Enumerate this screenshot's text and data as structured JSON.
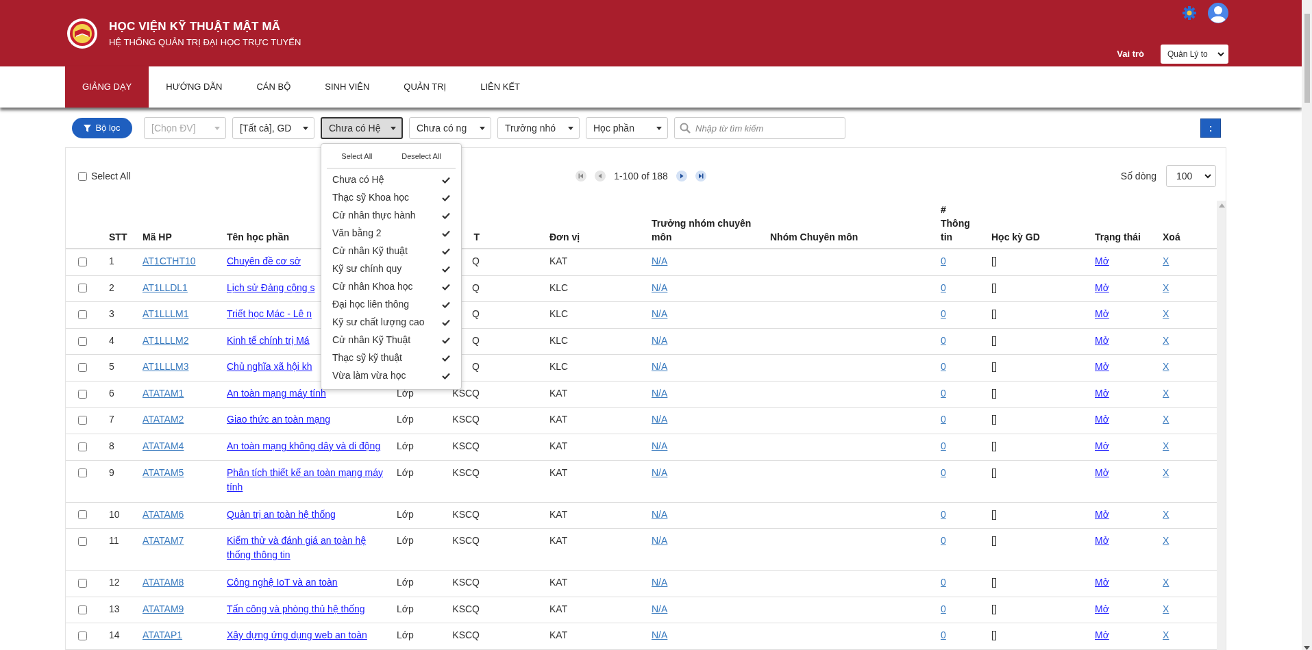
{
  "header": {
    "title": "HỌC VIỆN KỸ THUẬT MẬT MÃ",
    "subtitle": "HỆ THỐNG QUẢN TRỊ ĐẠI HỌC TRỰC TUYẾN",
    "role_label": "Vai trò",
    "role_select": "Quản Lý to"
  },
  "nav": [
    {
      "label": "GIẢNG DẠY",
      "selected": true
    },
    {
      "label": "HƯỚNG DẪN",
      "selected": false
    },
    {
      "label": "CÁN BỘ",
      "selected": false
    },
    {
      "label": "SINH VIÊN",
      "selected": false
    },
    {
      "label": "QUẢN TRỊ",
      "selected": false
    },
    {
      "label": "LIÊN KẾT",
      "selected": false
    }
  ],
  "filters": {
    "filter_button": "Bộ lọc",
    "dropdowns": [
      {
        "label": "[Chọn ĐV]",
        "disabled": true,
        "open": false
      },
      {
        "label": "[Tất cả], GD",
        "disabled": false,
        "open": false
      },
      {
        "label": "Chưa có Hệ",
        "disabled": false,
        "open": true
      },
      {
        "label": "Chưa có ng",
        "disabled": false,
        "open": false
      },
      {
        "label": "Trưởng nhó",
        "disabled": false,
        "open": false
      },
      {
        "label": "Học phần",
        "disabled": false,
        "open": false
      }
    ],
    "search": {
      "placeholder": "Nhập từ tìm kiếm"
    },
    "more_button": ":"
  },
  "dropdown_menu": {
    "select_all": "Select All",
    "deselect_all": "Deselect All",
    "items": [
      {
        "label": "Chưa có Hệ",
        "checked": true
      },
      {
        "label": "Thạc sỹ Khoa học",
        "checked": true
      },
      {
        "label": "Cử nhân thực hành",
        "checked": true
      },
      {
        "label": "Văn bằng 2",
        "checked": true
      },
      {
        "label": "Cử nhân Kỹ thuật",
        "checked": true
      },
      {
        "label": "Kỹ sư chính quy",
        "checked": true
      },
      {
        "label": "Cử nhân Khoa học",
        "checked": true
      },
      {
        "label": "Đại học liên thông",
        "checked": true
      },
      {
        "label": "Kỹ sư chất lượng cao",
        "checked": true
      },
      {
        "label": "Cử nhân Kỹ Thuật",
        "checked": true
      },
      {
        "label": "Thạc sỹ kỹ thuật",
        "checked": true
      },
      {
        "label": "Vừa làm vừa học",
        "checked": true
      }
    ]
  },
  "toolbar": {
    "select_all": {
      "label": "Select All",
      "checked": false
    },
    "pagination": "1-100 of 188",
    "rows_label": "Số dòng",
    "rows_select": "100"
  },
  "table": {
    "columns": [
      {
        "kind": "text",
        "label": "STT"
      },
      {
        "kind": "link",
        "label": "Mã HP"
      },
      {
        "kind": "title-link",
        "label": "Tên học phần"
      },
      {
        "kind": "text"
      },
      {
        "kind": "right",
        "label": "T"
      },
      {
        "kind": "text",
        "label": "Đơn vị"
      },
      {
        "kind": "link",
        "label": "Trưởng nhóm chuyên môn"
      },
      {
        "kind": "text",
        "label": "Nhóm Chuyên môn"
      },
      {
        "kind": "link",
        "label": "# Thông tin"
      },
      {
        "kind": "text",
        "label": "Học kỳ GD"
      },
      {
        "kind": "title-link",
        "label": "Trạng thái"
      },
      {
        "kind": "link",
        "label": "Xoá"
      }
    ],
    "rows": [
      {
        "checked": false,
        "stt": "1",
        "code": "AT1CTHT10",
        "name": "Chuyên đề cơ sở",
        "program": "Q",
        "unit": "KAT",
        "lead": "N/A",
        "info": "0",
        "semester": "[]",
        "status": "Mở",
        "delete": "X"
      },
      {
        "checked": false,
        "stt": "2",
        "code": "AT1LLDL1",
        "name": "Lịch sử Đảng cộng s",
        "program": "Q",
        "unit": "KLC",
        "lead": "N/A",
        "info": "0",
        "semester": "[]",
        "status": "Mở",
        "delete": "X"
      },
      {
        "checked": false,
        "stt": "3",
        "code": "AT1LLLM1",
        "name": "Triết học Mác - Lê n",
        "program": "Q",
        "unit": "KLC",
        "lead": "N/A",
        "info": "0",
        "semester": "[]",
        "status": "Mở",
        "delete": "X"
      },
      {
        "checked": false,
        "stt": "4",
        "code": "AT1LLLM2",
        "name": "Kinh tế chính trị Má",
        "program": "Q",
        "unit": "KLC",
        "lead": "N/A",
        "info": "0",
        "semester": "[]",
        "status": "Mở",
        "delete": "X"
      },
      {
        "checked": false,
        "stt": "5",
        "code": "AT1LLLM3",
        "name": "Chủ nghĩa xã hội kh",
        "program": "Q",
        "unit": "KLC",
        "lead": "N/A",
        "info": "0",
        "semester": "[]",
        "status": "Mở",
        "delete": "X"
      },
      {
        "checked": false,
        "stt": "6",
        "code": "ATATAM1",
        "name": "An toàn mạng máy tính",
        "type": "Lớp",
        "program": "KSCQ",
        "unit": "KAT",
        "lead": "N/A",
        "info": "0",
        "semester": "[]",
        "status": "Mở",
        "delete": "X"
      },
      {
        "checked": false,
        "stt": "7",
        "code": "ATATAM2",
        "name": "Giao thức an toàn mạng",
        "type": "Lớp",
        "program": "KSCQ",
        "unit": "KAT",
        "lead": "N/A",
        "info": "0",
        "semester": "[]",
        "status": "Mở",
        "delete": "X"
      },
      {
        "checked": false,
        "stt": "8",
        "code": "ATATAM4",
        "name": "An toàn mạng không dây và di động",
        "type": "Lớp",
        "program": "KSCQ",
        "unit": "KAT",
        "lead": "N/A",
        "info": "0",
        "semester": "[]",
        "status": "Mở",
        "delete": "X"
      },
      {
        "checked": false,
        "stt": "9",
        "code": "ATATAM5",
        "name": "Phân tích thiết kế an toàn mạng máy tính",
        "type": "Lớp",
        "program": "KSCQ",
        "unit": "KAT",
        "lead": "N/A",
        "info": "0",
        "semester": "[]",
        "status": "Mở",
        "delete": "X"
      },
      {
        "checked": false,
        "stt": "10",
        "code": "ATATAM6",
        "name": "Quản trị an toàn hệ thống",
        "type": "Lớp",
        "program": "KSCQ",
        "unit": "KAT",
        "lead": "N/A",
        "info": "0",
        "semester": "[]",
        "status": "Mở",
        "delete": "X"
      },
      {
        "checked": false,
        "stt": "11",
        "code": "ATATAM7",
        "name": "Kiểm thử và đánh giá an toàn hệ thống thông tin",
        "type": "Lớp",
        "program": "KSCQ",
        "unit": "KAT",
        "lead": "N/A",
        "info": "0",
        "semester": "[]",
        "status": "Mở",
        "delete": "X"
      },
      {
        "checked": false,
        "stt": "12",
        "code": "ATATAM8",
        "name": "Công nghệ IoT và an toàn",
        "type": "Lớp",
        "program": "KSCQ",
        "unit": "KAT",
        "lead": "N/A",
        "info": "0",
        "semester": "[]",
        "status": "Mở",
        "delete": "X"
      },
      {
        "checked": false,
        "stt": "13",
        "code": "ATATAM9",
        "name": "Tấn công và phòng thủ hệ thống",
        "type": "Lớp",
        "program": "KSCQ",
        "unit": "KAT",
        "lead": "N/A",
        "info": "0",
        "semester": "[]",
        "status": "Mở",
        "delete": "X"
      },
      {
        "checked": false,
        "stt": "14",
        "code": "ATATAP1",
        "name": "Xây dựng ứng dụng web an toàn",
        "type": "Lớp",
        "program": "KSCQ",
        "unit": "KAT",
        "lead": "N/A",
        "info": "0",
        "semester": "[]",
        "status": "Mở",
        "delete": "X"
      }
    ]
  }
}
